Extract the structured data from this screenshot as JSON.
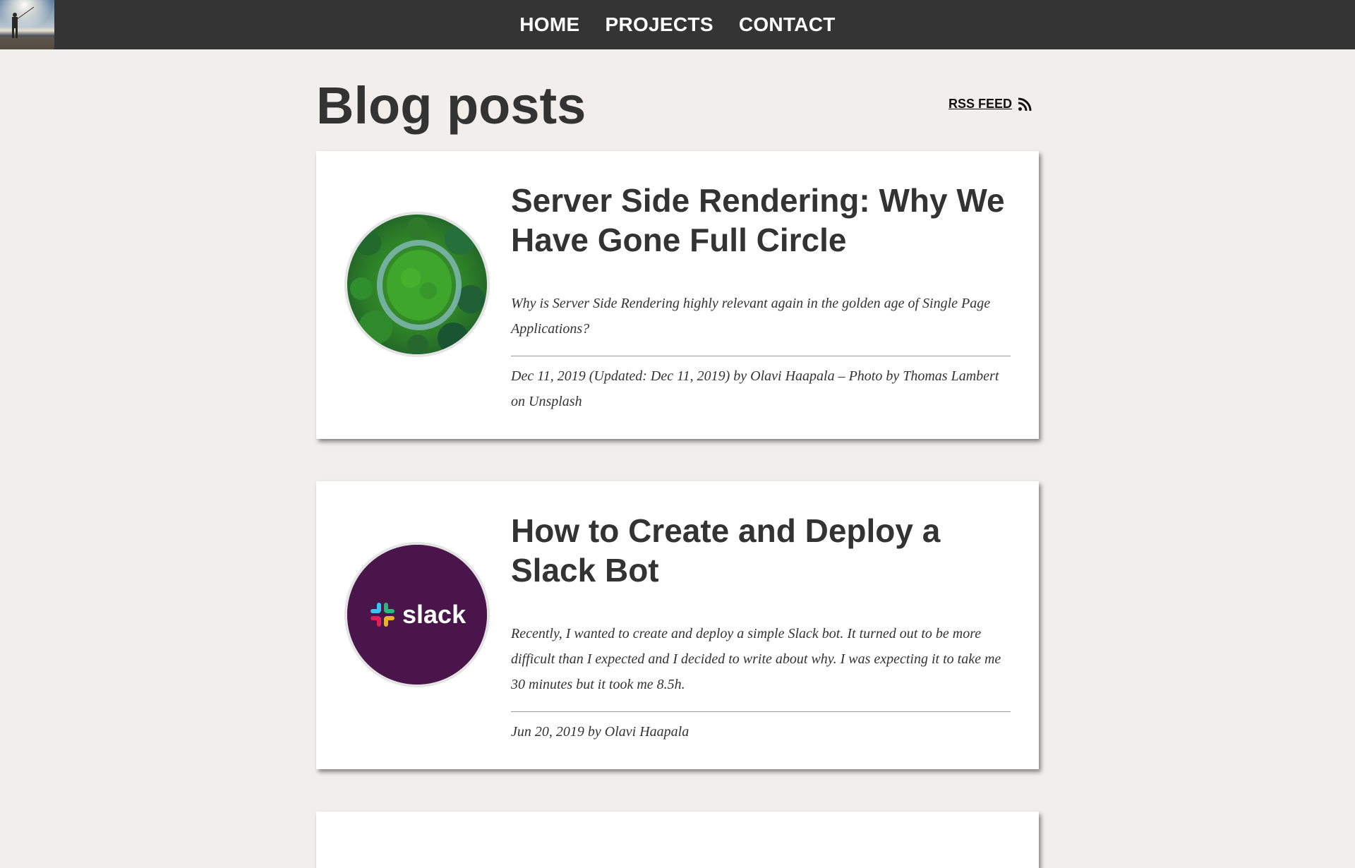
{
  "nav": {
    "items": [
      "HOME",
      "PROJECTS",
      "CONTACT"
    ]
  },
  "header": {
    "title": "Blog posts",
    "rss_label": "RSS FEED"
  },
  "posts": [
    {
      "title": "Server Side Rendering: Why We Have Gone Full Circle",
      "excerpt": "Why is Server Side Rendering highly relevant again in the golden age of Single Page Applications?",
      "meta": "Dec 11, 2019 (Updated: Dec 11, 2019) by Olavi Haapala – Photo by Thomas Lambert on Unsplash"
    },
    {
      "title": "How to Create and Deploy a Slack Bot",
      "excerpt": "Recently, I wanted to create and deploy a simple Slack bot. It turned out to be more difficult than I expected and I decided to write about why. I was expecting it to take me 30 minutes but it took me 8.5h.",
      "meta": "Jun 20, 2019 by Olavi Haapala",
      "logo_text": "slack"
    }
  ],
  "colors": {
    "topbar": "#343434",
    "page_bg": "#f0efed",
    "slack_purple": "#4a154b",
    "slack_blue": "#36c5f0",
    "slack_green": "#2eb67d",
    "slack_yellow": "#ecb22e",
    "slack_red": "#e01e5a"
  },
  "icons": {
    "rss": "rss-icon",
    "site_avatar": "fisherman-sunset-photo"
  }
}
